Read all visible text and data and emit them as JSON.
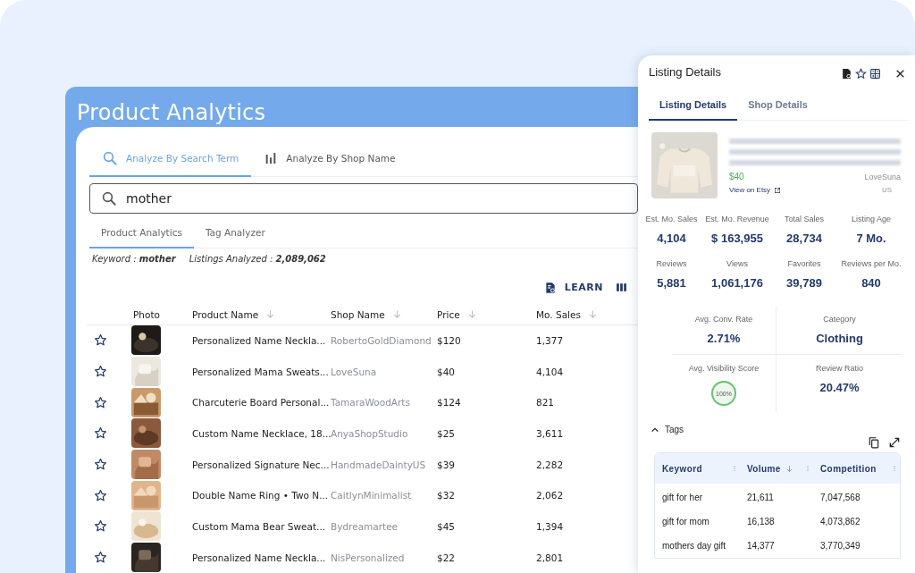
{
  "main": {
    "title": "Product Analytics"
  },
  "search_tabs": [
    {
      "label": "Analyze By Search Term",
      "kind": "search",
      "selected": true
    },
    {
      "label": "Analyze By Shop Name",
      "kind": "bars",
      "selected": false
    }
  ],
  "search": {
    "value": "mother"
  },
  "sub_tabs": [
    {
      "label": "Product Analytics",
      "selected": true
    },
    {
      "label": "Tag Analyzer",
      "selected": false
    }
  ],
  "summary": [
    {
      "label": "Keyword :",
      "value": "mother"
    },
    {
      "label": "Listings Analyzed :",
      "value": "2,089,062"
    }
  ],
  "toolbar": {
    "learn": "LEARN"
  },
  "table": {
    "columns": [
      {
        "label": "Photo",
        "sortable": false
      },
      {
        "label": "Product Name",
        "sortable": true
      },
      {
        "label": "Shop Name",
        "sortable": true
      },
      {
        "label": "Price",
        "sortable": true
      },
      {
        "label": "Mo. Sales",
        "sortable": true
      }
    ],
    "rows": [
      {
        "favorite": false,
        "product": "Personalized Name Neckla...",
        "shop": "RobertoGoldDiamond",
        "price": "$120",
        "sales": "1,377"
      },
      {
        "favorite": false,
        "product": "Personalized Mama Sweats...",
        "shop": "LoveSuna",
        "price": "$40",
        "sales": "4,104"
      },
      {
        "favorite": false,
        "product": "Charcuterie Board Personal...",
        "shop": "TamaraWoodArts",
        "price": "$124",
        "sales": "821"
      },
      {
        "favorite": false,
        "product": "Custom Name Necklace, 18...",
        "shop": "AnyaShopStudio",
        "price": "$25",
        "sales": "3,611"
      },
      {
        "favorite": false,
        "product": "Personalized Signature Nec...",
        "shop": "HandmadeDaintyUS",
        "price": "$39",
        "sales": "2,282"
      },
      {
        "favorite": false,
        "product": "Double Name Ring • Two N...",
        "shop": "CaitlynMinimalist",
        "price": "$32",
        "sales": "2,062"
      },
      {
        "favorite": false,
        "product": "Custom Mama Bear Sweat...",
        "shop": "Bydreamartee",
        "price": "$45",
        "sales": "1,394"
      },
      {
        "favorite": false,
        "product": "Personalized Name Neckla...",
        "shop": "NisPersonalized",
        "price": "$22",
        "sales": "2,801"
      }
    ]
  },
  "panel": {
    "title": "Listing Details",
    "tabs": [
      {
        "label": "Listing Details",
        "selected": true
      },
      {
        "label": "Shop Details",
        "selected": false
      }
    ],
    "listing": {
      "price": "$40",
      "link": "View on Etsy",
      "shop": "LoveSuna",
      "country": "US"
    },
    "stats": [
      {
        "label": "Est. Mo. Sales",
        "value": "4,104"
      },
      {
        "label": "Est. Mo. Revenue",
        "value": "$ 163,955"
      },
      {
        "label": "Total Sales",
        "value": "28,734"
      },
      {
        "label": "Listing Age",
        "value": "7 Mo."
      },
      {
        "label": "Reviews",
        "value": "5,881"
      },
      {
        "label": "Views",
        "value": "1,061,176"
      },
      {
        "label": "Favorites",
        "value": "39,789"
      },
      {
        "label": "Reviews per Mo.",
        "value": "840"
      }
    ],
    "metrics": [
      {
        "kind": "text",
        "label": "Avg. Conv. Rate",
        "value": "2.71%"
      },
      {
        "kind": "text",
        "label": "Category",
        "value": "Clothing"
      },
      {
        "kind": "ring",
        "label": "Avg. Visibility Score",
        "value": "100%",
        "level": 1
      },
      {
        "kind": "text",
        "label": "Review Ratio",
        "value": "20.47%"
      }
    ],
    "tags": {
      "title": "Tags",
      "expanded": true,
      "columns": [
        {
          "label": "Keyword",
          "sorted": false
        },
        {
          "label": "Volume",
          "sorted": true
        },
        {
          "label": "Competition",
          "sorted": false
        }
      ],
      "rows": [
        [
          "gift for her",
          "21,611",
          "7,047,568"
        ],
        [
          "gift for mom",
          "16,138",
          "4,073,862"
        ],
        [
          "mothers day gift",
          "14,377",
          "3,770,349"
        ]
      ]
    }
  }
}
